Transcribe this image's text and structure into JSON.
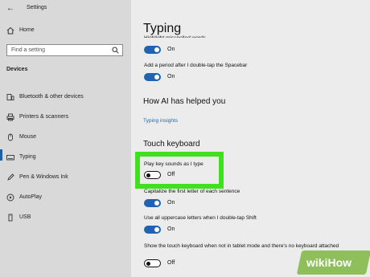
{
  "app": {
    "title": "Settings",
    "back_icon": "back-arrow-icon"
  },
  "sidebar": {
    "home_label": "Home",
    "search_placeholder": "Find a setting",
    "section": "Devices",
    "items": [
      {
        "label": "Bluetooth & other devices",
        "icon": "bluetooth-icon"
      },
      {
        "label": "Printers & scanners",
        "icon": "printer-icon"
      },
      {
        "label": "Mouse",
        "icon": "mouse-icon"
      },
      {
        "label": "Typing",
        "icon": "keyboard-icon",
        "active": true
      },
      {
        "label": "Pen & Windows Ink",
        "icon": "pen-icon"
      },
      {
        "label": "AutoPlay",
        "icon": "autoplay-icon"
      },
      {
        "label": "USB",
        "icon": "usb-icon"
      }
    ]
  },
  "main": {
    "title": "Typing",
    "settings_top": [
      {
        "label": "Highlight misspelled words",
        "state": "On"
      },
      {
        "label": "Add a period after I double-tap the Spacebar",
        "state": "On"
      }
    ],
    "ai_heading": "How AI has helped you",
    "ai_link": "Typing insights",
    "touch_heading": "Touch keyboard",
    "touch_settings": [
      {
        "label": "Play key sounds as I type",
        "state": "Off"
      },
      {
        "label": "Capitalize the first letter of each sentence",
        "state": "On"
      },
      {
        "label": "Use all uppercase letters when I double-tap Shift",
        "state": "On"
      },
      {
        "label": "Show the touch keyboard when not in tablet mode and there's no keyboard attached",
        "state": "Off"
      }
    ]
  },
  "colors": {
    "accent": "#1f63b4",
    "highlight": "#40e020",
    "link": "#1e6bb8"
  },
  "watermark": "wikiHow"
}
